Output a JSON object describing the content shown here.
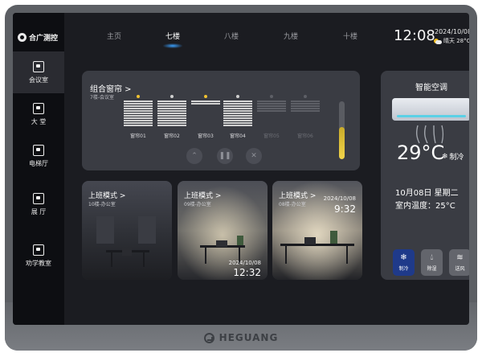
{
  "brand": {
    "name": "HEGUANG"
  },
  "sidebar": {
    "logo_text": "合广测控",
    "items": [
      {
        "label": "会议室",
        "active": true
      },
      {
        "label": "大 堂"
      },
      {
        "label": "电梯厅"
      },
      {
        "label": "展 厅"
      },
      {
        "label": "劝学教室"
      }
    ]
  },
  "tabs": [
    {
      "label": "主页"
    },
    {
      "label": "七楼",
      "active": true
    },
    {
      "label": "八楼"
    },
    {
      "label": "九楼"
    },
    {
      "label": "十楼"
    }
  ],
  "header": {
    "time": "12:08",
    "date": "2024/10/08",
    "weather": "晴天 28°C"
  },
  "curtains": {
    "title": "组合窗帘 >",
    "subtitle": "7楼-会议室",
    "items": [
      {
        "label": "窗帘01",
        "state": "on"
      },
      {
        "label": "窗帘02",
        "state": "off"
      },
      {
        "label": "窗帘03",
        "state": "on"
      },
      {
        "label": "窗帘04",
        "state": "off"
      },
      {
        "label": "窗帘05",
        "state": "disabled"
      },
      {
        "label": "窗帘06",
        "state": "disabled"
      }
    ],
    "controls": [
      "up-down",
      "pause",
      "close"
    ],
    "level": 0.55
  },
  "scenes": [
    {
      "title": "上班模式 >",
      "subtitle": "10楼-办公室",
      "date": "",
      "time": ""
    },
    {
      "title": "上班模式 >",
      "subtitle": "09楼-办公室",
      "date": "2024/10/08",
      "time": "12:32"
    },
    {
      "title": "上班模式 >",
      "subtitle": "08楼-办公室",
      "date": "2024/10/08",
      "time": "9:32"
    }
  ],
  "ac": {
    "title": "智能空调",
    "temperature": "29°C",
    "mode": "制冷",
    "date_line": "10月08日  星期二",
    "indoor_line": "室内温度：25°C",
    "modes": [
      {
        "label": "制冷",
        "icon": "snowflake-icon",
        "active": true
      },
      {
        "label": "除湿",
        "icon": "droplet-icon"
      },
      {
        "label": "送风",
        "icon": "wind-icon"
      }
    ]
  },
  "colors": {
    "accent": "#3aa0ff",
    "slider": "#f2d44a",
    "active_mode": "#1f3a8a",
    "indicator_on": "#f2c230"
  }
}
